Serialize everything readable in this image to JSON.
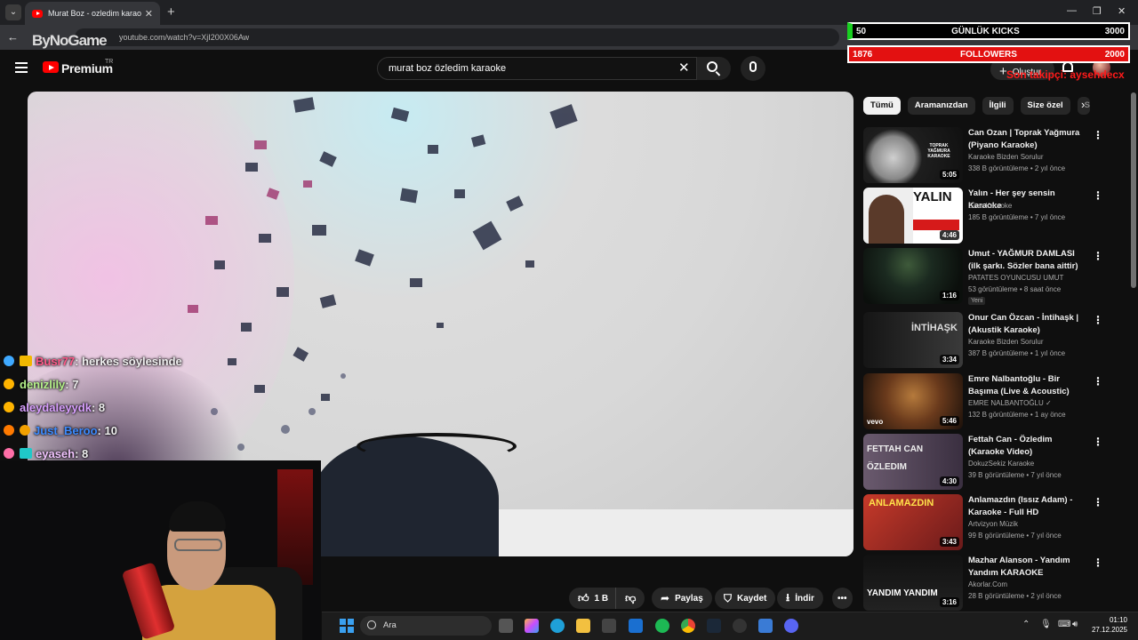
{
  "browser": {
    "tab_title": "Murat Boz - ozledim karaoke -",
    "tab_close": "✕",
    "new_tab": "+",
    "url": "youtube.com/watch?v=XjI200X06Aw"
  },
  "overlay": {
    "logo": "ByNoGame",
    "stats": [
      {
        "left": "50",
        "label": "GÜNLÜK KICKS",
        "right": "3000"
      },
      {
        "left": "1876",
        "label": "FOLLOWERS",
        "right": "2000"
      }
    ],
    "red_text": "Son takipçi: aysehdecx",
    "chat": [
      {
        "user": "Busr77",
        "msg": ": herkes söylesinde",
        "color": "#ff5a8a"
      },
      {
        "user": "denizlily",
        "msg": ": 7",
        "color": "#b5f28a"
      },
      {
        "user": "aleydaleyydk",
        "msg": ": 8",
        "color": "#d9a0ff"
      },
      {
        "user": "Just_Beroo",
        "msg": ": 10",
        "color": "#3d8bff"
      },
      {
        "user": "eyaseh",
        "msg": ": 8",
        "color": "#f2c5ff"
      }
    ]
  },
  "youtube": {
    "brand": "Premium",
    "brand_sup": "TR",
    "search_value": "murat boz özledim karaoke",
    "create_label": "Oluştur",
    "actions": {
      "likes": "1 B",
      "share": "Paylaş",
      "save": "Kaydet",
      "download": "İndir",
      "more": "•••"
    },
    "chips": [
      "Tümü",
      "Aramanızdan",
      "İlgili",
      "Size özel",
      "S"
    ],
    "recommendations": [
      {
        "title": "Can Ozan | Toprak Yağmura (Piyano Karaoke)",
        "channel": "Karaoke Bizden Sorulur",
        "meta": "338 B görüntüleme • 2 yıl önce",
        "duration": "5:05",
        "thumb_text": "TOPRAK YAĞMURA KARAOKE"
      },
      {
        "title": "Yalın - Her şey sensin Karaoke",
        "channel": "Gitar Karaoke",
        "meta": "185 B görüntüleme • 7 yıl önce",
        "duration": "4:46",
        "thumb_text": "YALIN"
      },
      {
        "title": "Umut - YAĞMUR DAMLASI  (ilk şarkı. Sözler bana aittir)",
        "channel": "PATATES OYUNCUSU UMUT",
        "meta": "53 görüntüleme • 8 saat önce",
        "duration": "1:16",
        "badge": "Yeni"
      },
      {
        "title": "Onur Can Özcan - İntihaşk | (Akustik Karaoke)",
        "channel": "Karaoke Bizden Sorulur",
        "meta": "387 B görüntüleme • 1 yıl önce",
        "duration": "3:34",
        "thumb_text": "İNTİHAŞK"
      },
      {
        "title": "Emre Nalbantoğlu - Bir Başıma (Live & Acoustic)",
        "channel": "EMRE NALBANTOĞLU",
        "meta": "132 B görüntüleme • 1 ay önce",
        "duration": "5:46",
        "thumb_text": "vevo"
      },
      {
        "title": "Fettah Can - Özledim (Karaoke Video)",
        "channel": "DokuzSekiz Karaoke",
        "meta": "39 B görüntüleme • 7 yıl önce",
        "duration": "4:30",
        "thumb_text": "FETTAH CAN ÖZLEDIM"
      },
      {
        "title": "Anlamazdın (Issız Adam) - Karaoke - Full HD",
        "channel": "Artvizyon Müzik",
        "meta": "99 B görüntüleme • 7 yıl önce",
        "duration": "3:43",
        "thumb_text": "ANLAMAZDIN"
      },
      {
        "title": "Mazhar Alanson - Yandım Yandım KARAOKE",
        "channel": "Akorlar.Com",
        "meta": "28 B görüntüleme • 2 yıl önce",
        "duration": "3:16",
        "thumb_text": "YANDIM YANDIM"
      }
    ]
  },
  "taskbar": {
    "search_placeholder": "Ara",
    "time": "01:10",
    "date": "27.12.2025"
  }
}
